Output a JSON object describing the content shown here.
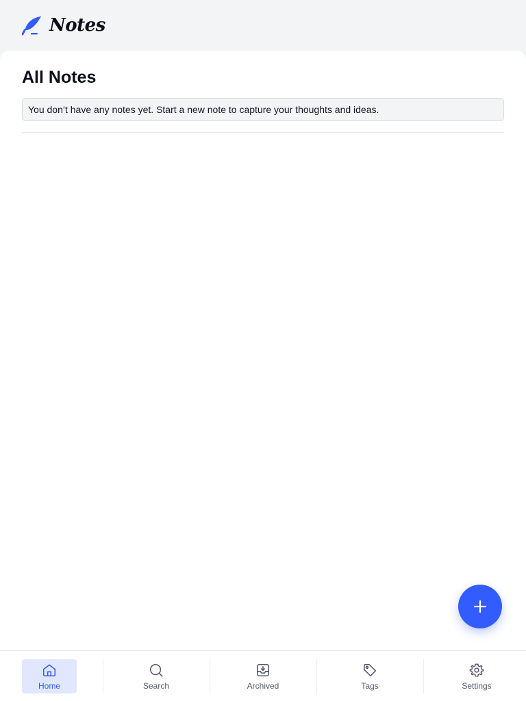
{
  "app": {
    "name": "Notes",
    "logo_icon": "feather-pen-icon",
    "accent_color": "#335cff"
  },
  "main": {
    "title": "All Notes",
    "empty_message": "You don’t have any notes yet. Start a new note to capture your thoughts and ideas."
  },
  "fab": {
    "icon": "plus-icon"
  },
  "bottom_nav": {
    "items": [
      {
        "label": "Home",
        "icon": "home-icon",
        "active": true
      },
      {
        "label": "Search",
        "icon": "search-icon",
        "active": false
      },
      {
        "label": "Archived",
        "icon": "archive-icon",
        "active": false
      },
      {
        "label": "Tags",
        "icon": "tag-icon",
        "active": false
      },
      {
        "label": "Settings",
        "icon": "gear-icon",
        "active": false
      }
    ]
  }
}
